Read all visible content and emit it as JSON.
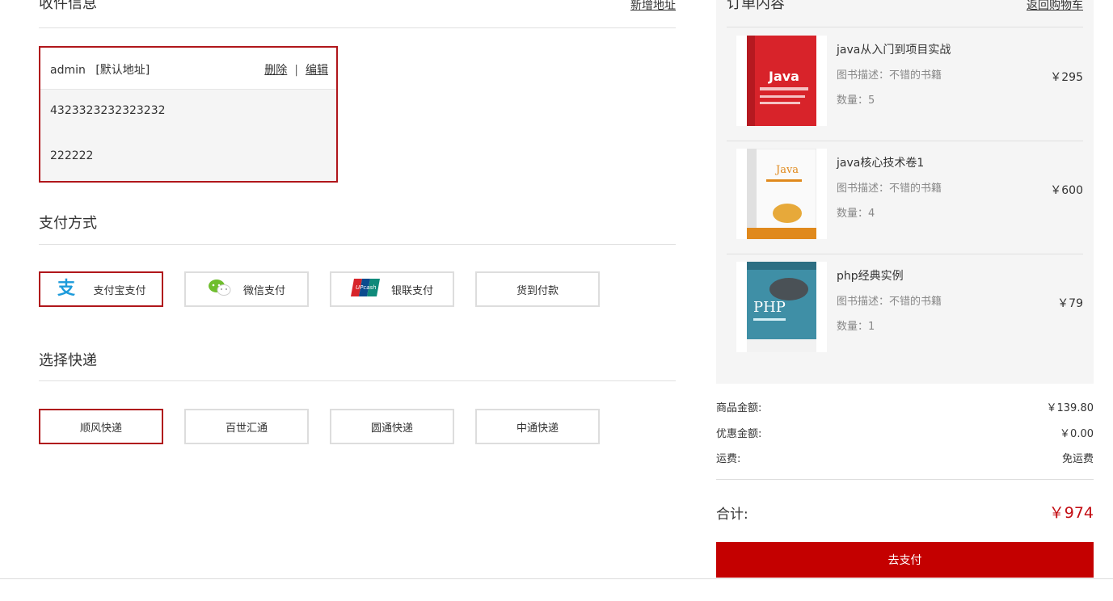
{
  "address_section": {
    "title": "收件信息",
    "add_link": "新增地址"
  },
  "address_card": {
    "name": "admin",
    "default_tag": "[默认地址]",
    "delete_label": "删除",
    "separator": "|",
    "edit_label": "编辑",
    "phone": "4323323232323232",
    "detail": "222222"
  },
  "payment_section": {
    "title": "支付方式",
    "options": [
      {
        "label": "支付宝支付",
        "icon": "alipay-icon",
        "selected": true
      },
      {
        "label": "微信支付",
        "icon": "wechat-icon",
        "selected": false
      },
      {
        "label": "银联支付",
        "icon": "unionpay-icon",
        "selected": false
      },
      {
        "label": "货到付款",
        "icon": "",
        "selected": false
      }
    ]
  },
  "shipping_section": {
    "title": "选择快递",
    "options": [
      {
        "label": "顺风快递",
        "selected": true
      },
      {
        "label": "百世汇通",
        "selected": false
      },
      {
        "label": "圆通快递",
        "selected": false
      },
      {
        "label": "中通快递",
        "selected": false
      }
    ]
  },
  "order": {
    "title": "订单内容",
    "back_link": "返回购物车",
    "items": [
      {
        "name": "java从入门到项目实战",
        "desc": "图书描述：不错的书籍",
        "qty": "数量：5",
        "price": "￥295",
        "cover_color": "#d8232a",
        "cover_text": "Java"
      },
      {
        "name": "java核心技术卷1",
        "desc": "图书描述：不错的书籍",
        "qty": "数量：4",
        "price": "￥600",
        "cover_color": "#f2f2f2",
        "cover_text": "Java"
      },
      {
        "name": "php经典实例",
        "desc": "图书描述：不错的书籍",
        "qty": "数量：1",
        "price": "￥79",
        "cover_color": "#3f8fa6",
        "cover_text": "PHP"
      }
    ]
  },
  "summary": {
    "goods_label": "商品金额:",
    "goods_value": "￥139.80",
    "discount_label": "优惠金额:",
    "discount_value": "￥0.00",
    "shipping_label": "运费:",
    "shipping_value": "免运费",
    "total_label": "合计:",
    "total_value": "￥974",
    "pay_button": "去支付"
  },
  "colors": {
    "accent": "#b0161b",
    "pay_button": "#c40000",
    "panel_bg": "#f5f5f5"
  }
}
